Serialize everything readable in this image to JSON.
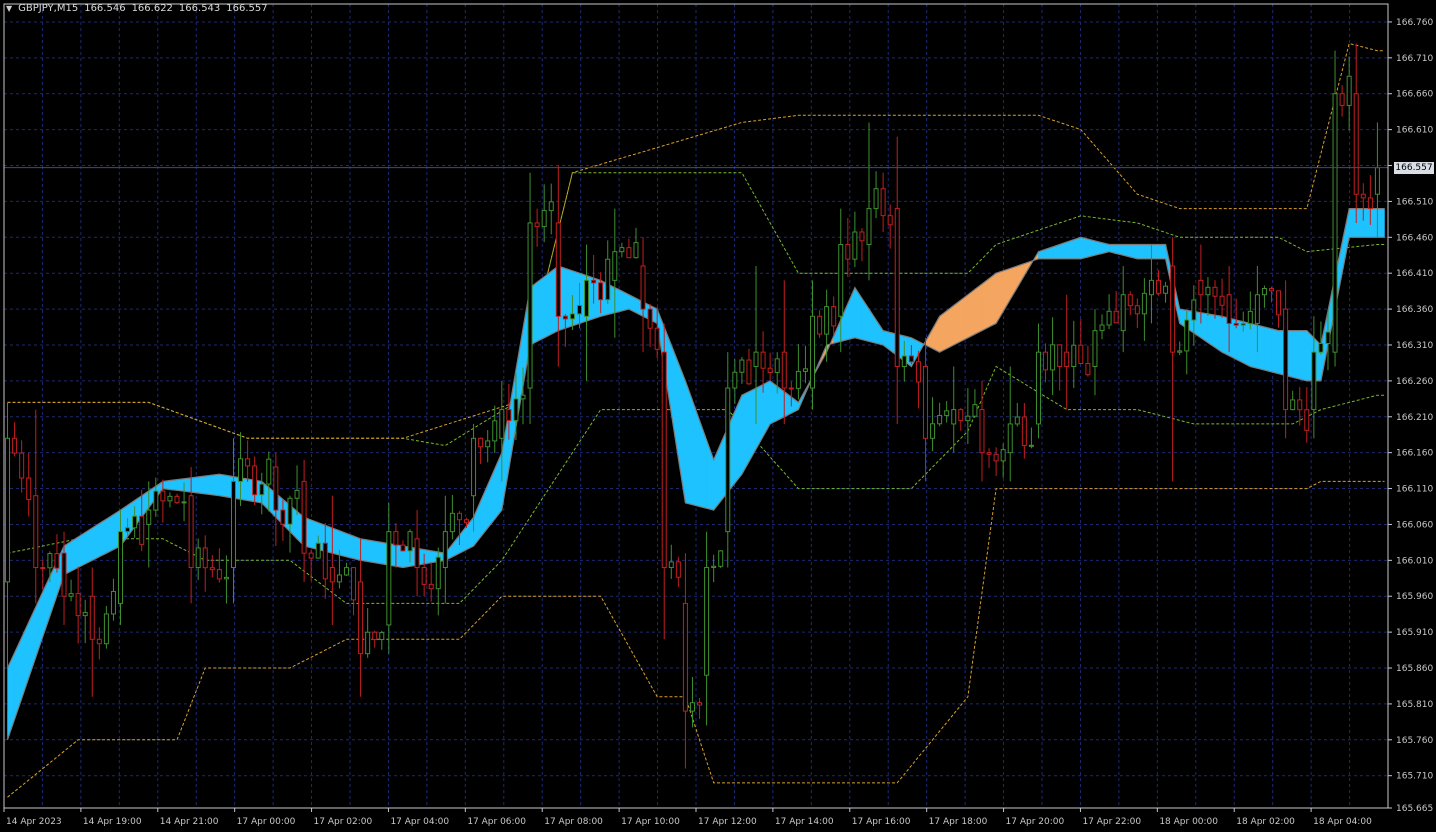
{
  "header": {
    "symbol": "GBPJPY,M15",
    "open": "166.546",
    "high": "166.622",
    "low": "166.543",
    "close": "166.557"
  },
  "current_price_label": "166.557",
  "colors": {
    "background": "#000000",
    "grid": "#1e2a6e",
    "axis": "#c8c8c8",
    "bull": "#3e8f2f",
    "bear": "#c21f1f",
    "cloud_up": "#1ec2ff",
    "cloud_down": "#f4a560",
    "band_inner": "#7ab82b",
    "band_outer": "#d8a028",
    "price_line": "#3a4a9a"
  },
  "chart_data": {
    "type": "candlestick",
    "symbol": "GBPJPY",
    "timeframe": "M15",
    "ylim": [
      165.665,
      166.785
    ],
    "y_ticks": [
      "166.760",
      "166.710",
      "166.660",
      "166.610",
      "166.560",
      "166.510",
      "166.460",
      "166.410",
      "166.360",
      "166.310",
      "166.260",
      "166.210",
      "166.160",
      "166.110",
      "166.060",
      "166.010",
      "165.960",
      "165.910",
      "165.860",
      "165.810",
      "165.760",
      "165.710",
      "165.665"
    ],
    "x_ticks": [
      "14 Apr 2023",
      "14 Apr 19:00",
      "14 Apr 21:00",
      "17 Apr 00:00",
      "17 Apr 02:00",
      "17 Apr 04:00",
      "17 Apr 06:00",
      "17 Apr 08:00",
      "17 Apr 10:00",
      "17 Apr 12:00",
      "17 Apr 14:00",
      "17 Apr 16:00",
      "17 Apr 18:00",
      "17 Apr 20:00",
      "17 Apr 22:00",
      "18 Apr 00:00",
      "18 Apr 02:00",
      "18 Apr 04:00"
    ],
    "current_price": 166.557,
    "anchors": [
      {
        "i": 0,
        "o": 165.98,
        "h": 166.23,
        "l": 165.8,
        "c": 166.18
      },
      {
        "i": 4,
        "o": 166.1,
        "h": 166.22,
        "l": 165.95,
        "c": 166.0
      },
      {
        "i": 8,
        "o": 166.02,
        "h": 166.05,
        "l": 165.92,
        "c": 165.96
      },
      {
        "i": 12,
        "o": 165.96,
        "h": 166.0,
        "l": 165.82,
        "c": 165.9
      },
      {
        "i": 16,
        "o": 165.95,
        "h": 166.08,
        "l": 165.92,
        "c": 166.05
      },
      {
        "i": 20,
        "o": 166.06,
        "h": 166.12,
        "l": 166.0,
        "c": 166.08
      },
      {
        "i": 26,
        "o": 166.1,
        "h": 166.14,
        "l": 165.95,
        "c": 166.0
      },
      {
        "i": 32,
        "o": 166.0,
        "h": 166.18,
        "l": 165.95,
        "c": 166.12
      },
      {
        "i": 38,
        "o": 166.14,
        "h": 166.16,
        "l": 166.03,
        "c": 166.08
      },
      {
        "i": 42,
        "o": 166.12,
        "h": 166.15,
        "l": 165.98,
        "c": 166.02
      },
      {
        "i": 46,
        "o": 166.0,
        "h": 166.1,
        "l": 165.92,
        "c": 165.98
      },
      {
        "i": 50,
        "o": 165.98,
        "h": 166.04,
        "l": 165.82,
        "c": 165.88
      },
      {
        "i": 54,
        "o": 165.92,
        "h": 166.09,
        "l": 165.88,
        "c": 166.05
      },
      {
        "i": 58,
        "o": 166.04,
        "h": 166.08,
        "l": 165.96,
        "c": 166.0
      },
      {
        "i": 62,
        "o": 166.0,
        "h": 166.1,
        "l": 165.95,
        "c": 166.05
      },
      {
        "i": 66,
        "o": 166.1,
        "h": 166.2,
        "l": 166.05,
        "c": 166.18
      },
      {
        "i": 70,
        "o": 166.18,
        "h": 166.26,
        "l": 166.12,
        "c": 166.22
      },
      {
        "i": 74,
        "o": 166.25,
        "h": 166.55,
        "l": 166.2,
        "c": 166.48
      },
      {
        "i": 78,
        "o": 166.48,
        "h": 166.56,
        "l": 166.28,
        "c": 166.35
      },
      {
        "i": 82,
        "o": 166.35,
        "h": 166.45,
        "l": 166.26,
        "c": 166.4
      },
      {
        "i": 86,
        "o": 166.4,
        "h": 166.5,
        "l": 166.32,
        "c": 166.44
      },
      {
        "i": 90,
        "o": 166.42,
        "h": 166.46,
        "l": 166.3,
        "c": 166.36
      },
      {
        "i": 93,
        "o": 166.3,
        "h": 166.34,
        "l": 165.9,
        "c": 166.0
      },
      {
        "i": 96,
        "o": 165.95,
        "h": 166.02,
        "l": 165.72,
        "c": 165.8
      },
      {
        "i": 99,
        "o": 165.85,
        "h": 166.05,
        "l": 165.78,
        "c": 166.0
      },
      {
        "i": 102,
        "o": 166.05,
        "h": 166.3,
        "l": 166.0,
        "c": 166.25
      },
      {
        "i": 106,
        "o": 166.28,
        "h": 166.42,
        "l": 166.2,
        "c": 166.3
      },
      {
        "i": 110,
        "o": 166.3,
        "h": 166.4,
        "l": 166.2,
        "c": 166.25
      },
      {
        "i": 114,
        "o": 166.25,
        "h": 166.4,
        "l": 166.22,
        "c": 166.35
      },
      {
        "i": 118,
        "o": 166.35,
        "h": 166.5,
        "l": 166.3,
        "c": 166.45
      },
      {
        "i": 122,
        "o": 166.45,
        "h": 166.62,
        "l": 166.4,
        "c": 166.5
      },
      {
        "i": 126,
        "o": 166.5,
        "h": 166.6,
        "l": 166.2,
        "c": 166.28
      },
      {
        "i": 130,
        "o": 166.28,
        "h": 166.32,
        "l": 166.12,
        "c": 166.18
      },
      {
        "i": 134,
        "o": 166.2,
        "h": 166.28,
        "l": 166.16,
        "c": 166.22
      },
      {
        "i": 138,
        "o": 166.22,
        "h": 166.26,
        "l": 166.12,
        "c": 166.16
      },
      {
        "i": 142,
        "o": 166.16,
        "h": 166.28,
        "l": 166.12,
        "c": 166.2
      },
      {
        "i": 146,
        "o": 166.2,
        "h": 166.34,
        "l": 166.18,
        "c": 166.3
      },
      {
        "i": 150,
        "o": 166.3,
        "h": 166.38,
        "l": 166.22,
        "c": 166.28
      },
      {
        "i": 154,
        "o": 166.28,
        "h": 166.36,
        "l": 166.24,
        "c": 166.33
      },
      {
        "i": 158,
        "o": 166.33,
        "h": 166.42,
        "l": 166.3,
        "c": 166.38
      },
      {
        "i": 162,
        "o": 166.38,
        "h": 166.45,
        "l": 166.34,
        "c": 166.4
      },
      {
        "i": 165,
        "o": 166.42,
        "h": 166.46,
        "l": 166.12,
        "c": 166.3
      },
      {
        "i": 169,
        "o": 166.4,
        "h": 166.45,
        "l": 166.34,
        "c": 166.38
      },
      {
        "i": 173,
        "o": 166.38,
        "h": 166.42,
        "l": 166.3,
        "c": 166.34
      },
      {
        "i": 177,
        "o": 166.34,
        "h": 166.42,
        "l": 166.3,
        "c": 166.38
      },
      {
        "i": 181,
        "o": 166.36,
        "h": 166.4,
        "l": 166.18,
        "c": 166.22
      },
      {
        "i": 185,
        "o": 166.22,
        "h": 166.35,
        "l": 166.18,
        "c": 166.3
      },
      {
        "i": 188,
        "o": 166.3,
        "h": 166.72,
        "l": 166.28,
        "c": 166.66
      },
      {
        "i": 191,
        "o": 166.66,
        "h": 166.73,
        "l": 166.48,
        "c": 166.52
      },
      {
        "i": 194,
        "o": 166.52,
        "h": 166.62,
        "l": 166.46,
        "c": 166.557
      }
    ],
    "cloud": {
      "upper": [
        [
          0,
          165.86
        ],
        [
          8,
          166.03
        ],
        [
          16,
          166.08
        ],
        [
          22,
          166.12
        ],
        [
          30,
          166.13
        ],
        [
          36,
          166.12
        ],
        [
          42,
          166.07
        ],
        [
          50,
          166.04
        ],
        [
          56,
          166.03
        ],
        [
          62,
          166.02
        ],
        [
          66,
          166.07
        ],
        [
          70,
          166.16
        ],
        [
          74,
          166.39
        ],
        [
          78,
          166.42
        ],
        [
          84,
          166.4
        ],
        [
          88,
          166.38
        ],
        [
          92,
          166.36
        ],
        [
          96,
          166.26
        ],
        [
          100,
          166.15
        ],
        [
          104,
          166.24
        ],
        [
          108,
          166.26
        ],
        [
          112,
          166.23
        ],
        [
          116,
          166.3
        ],
        [
          120,
          166.39
        ],
        [
          124,
          166.33
        ],
        [
          128,
          166.32
        ],
        [
          132,
          166.3
        ],
        [
          136,
          166.32
        ],
        [
          140,
          166.34
        ],
        [
          146,
          166.44
        ],
        [
          152,
          166.46
        ],
        [
          156,
          166.45
        ],
        [
          160,
          166.45
        ],
        [
          164,
          166.45
        ],
        [
          166,
          166.36
        ],
        [
          172,
          166.35
        ],
        [
          176,
          166.34
        ],
        [
          180,
          166.33
        ],
        [
          184,
          166.33
        ],
        [
          186,
          166.31
        ],
        [
          190,
          166.5
        ],
        [
          194,
          166.5
        ]
      ],
      "lower": [
        [
          0,
          165.76
        ],
        [
          8,
          165.99
        ],
        [
          16,
          166.03
        ],
        [
          22,
          166.11
        ],
        [
          30,
          166.1
        ],
        [
          36,
          166.09
        ],
        [
          42,
          166.03
        ],
        [
          50,
          166.01
        ],
        [
          56,
          166.0
        ],
        [
          62,
          166.01
        ],
        [
          66,
          166.03
        ],
        [
          70,
          166.08
        ],
        [
          74,
          166.31
        ],
        [
          78,
          166.33
        ],
        [
          84,
          166.35
        ],
        [
          88,
          166.36
        ],
        [
          92,
          166.34
        ],
        [
          96,
          166.09
        ],
        [
          100,
          166.08
        ],
        [
          104,
          166.13
        ],
        [
          108,
          166.2
        ],
        [
          112,
          166.22
        ],
        [
          116,
          166.31
        ],
        [
          120,
          166.32
        ],
        [
          124,
          166.31
        ],
        [
          128,
          166.28
        ],
        [
          132,
          166.35
        ],
        [
          136,
          166.38
        ],
        [
          140,
          166.41
        ],
        [
          146,
          166.43
        ],
        [
          152,
          166.43
        ],
        [
          156,
          166.44
        ],
        [
          160,
          166.43
        ],
        [
          164,
          166.43
        ],
        [
          166,
          166.34
        ],
        [
          172,
          166.3
        ],
        [
          176,
          166.28
        ],
        [
          180,
          166.27
        ],
        [
          184,
          166.26
        ],
        [
          186,
          166.26
        ],
        [
          190,
          166.46
        ],
        [
          194,
          166.46
        ]
      ]
    },
    "bands": {
      "inner_upper": [
        [
          0,
          166.23
        ],
        [
          20,
          166.23
        ],
        [
          34,
          166.18
        ],
        [
          56,
          166.18
        ],
        [
          62,
          166.17
        ],
        [
          72,
          166.23
        ],
        [
          80,
          166.55
        ],
        [
          104,
          166.55
        ],
        [
          112,
          166.41
        ],
        [
          136,
          166.41
        ],
        [
          140,
          166.45
        ],
        [
          152,
          166.49
        ],
        [
          160,
          166.48
        ],
        [
          166,
          166.46
        ],
        [
          180,
          166.46
        ],
        [
          184,
          166.44
        ],
        [
          194,
          166.45
        ]
      ],
      "inner_lower": [
        [
          0,
          166.02
        ],
        [
          10,
          166.04
        ],
        [
          22,
          166.04
        ],
        [
          28,
          166.01
        ],
        [
          40,
          166.01
        ],
        [
          48,
          165.95
        ],
        [
          64,
          165.95
        ],
        [
          70,
          166.01
        ],
        [
          84,
          166.22
        ],
        [
          102,
          166.22
        ],
        [
          112,
          166.11
        ],
        [
          128,
          166.11
        ],
        [
          136,
          166.19
        ],
        [
          140,
          166.28
        ],
        [
          150,
          166.22
        ],
        [
          160,
          166.22
        ],
        [
          168,
          166.2
        ],
        [
          182,
          166.2
        ],
        [
          186,
          166.22
        ],
        [
          194,
          166.24
        ]
      ],
      "outer_upper": [
        [
          0,
          166.23
        ],
        [
          20,
          166.23
        ],
        [
          34,
          166.18
        ],
        [
          56,
          166.18
        ],
        [
          72,
          166.23
        ],
        [
          80,
          166.55
        ],
        [
          104,
          166.62
        ],
        [
          112,
          166.63
        ],
        [
          146,
          166.63
        ],
        [
          152,
          166.61
        ],
        [
          160,
          166.52
        ],
        [
          166,
          166.5
        ],
        [
          184,
          166.5
        ],
        [
          190,
          166.73
        ],
        [
          194,
          166.72
        ]
      ],
      "outer_lower": [
        [
          0,
          165.68
        ],
        [
          10,
          165.76
        ],
        [
          24,
          165.76
        ],
        [
          28,
          165.86
        ],
        [
          40,
          165.86
        ],
        [
          48,
          165.9
        ],
        [
          64,
          165.9
        ],
        [
          70,
          165.96
        ],
        [
          84,
          165.96
        ],
        [
          92,
          165.82
        ],
        [
          96,
          165.82
        ],
        [
          100,
          165.7
        ],
        [
          126,
          165.7
        ],
        [
          136,
          165.82
        ],
        [
          140,
          166.11
        ],
        [
          164,
          166.11
        ],
        [
          168,
          166.11
        ],
        [
          184,
          166.11
        ],
        [
          186,
          166.12
        ],
        [
          194,
          166.12
        ]
      ]
    }
  }
}
